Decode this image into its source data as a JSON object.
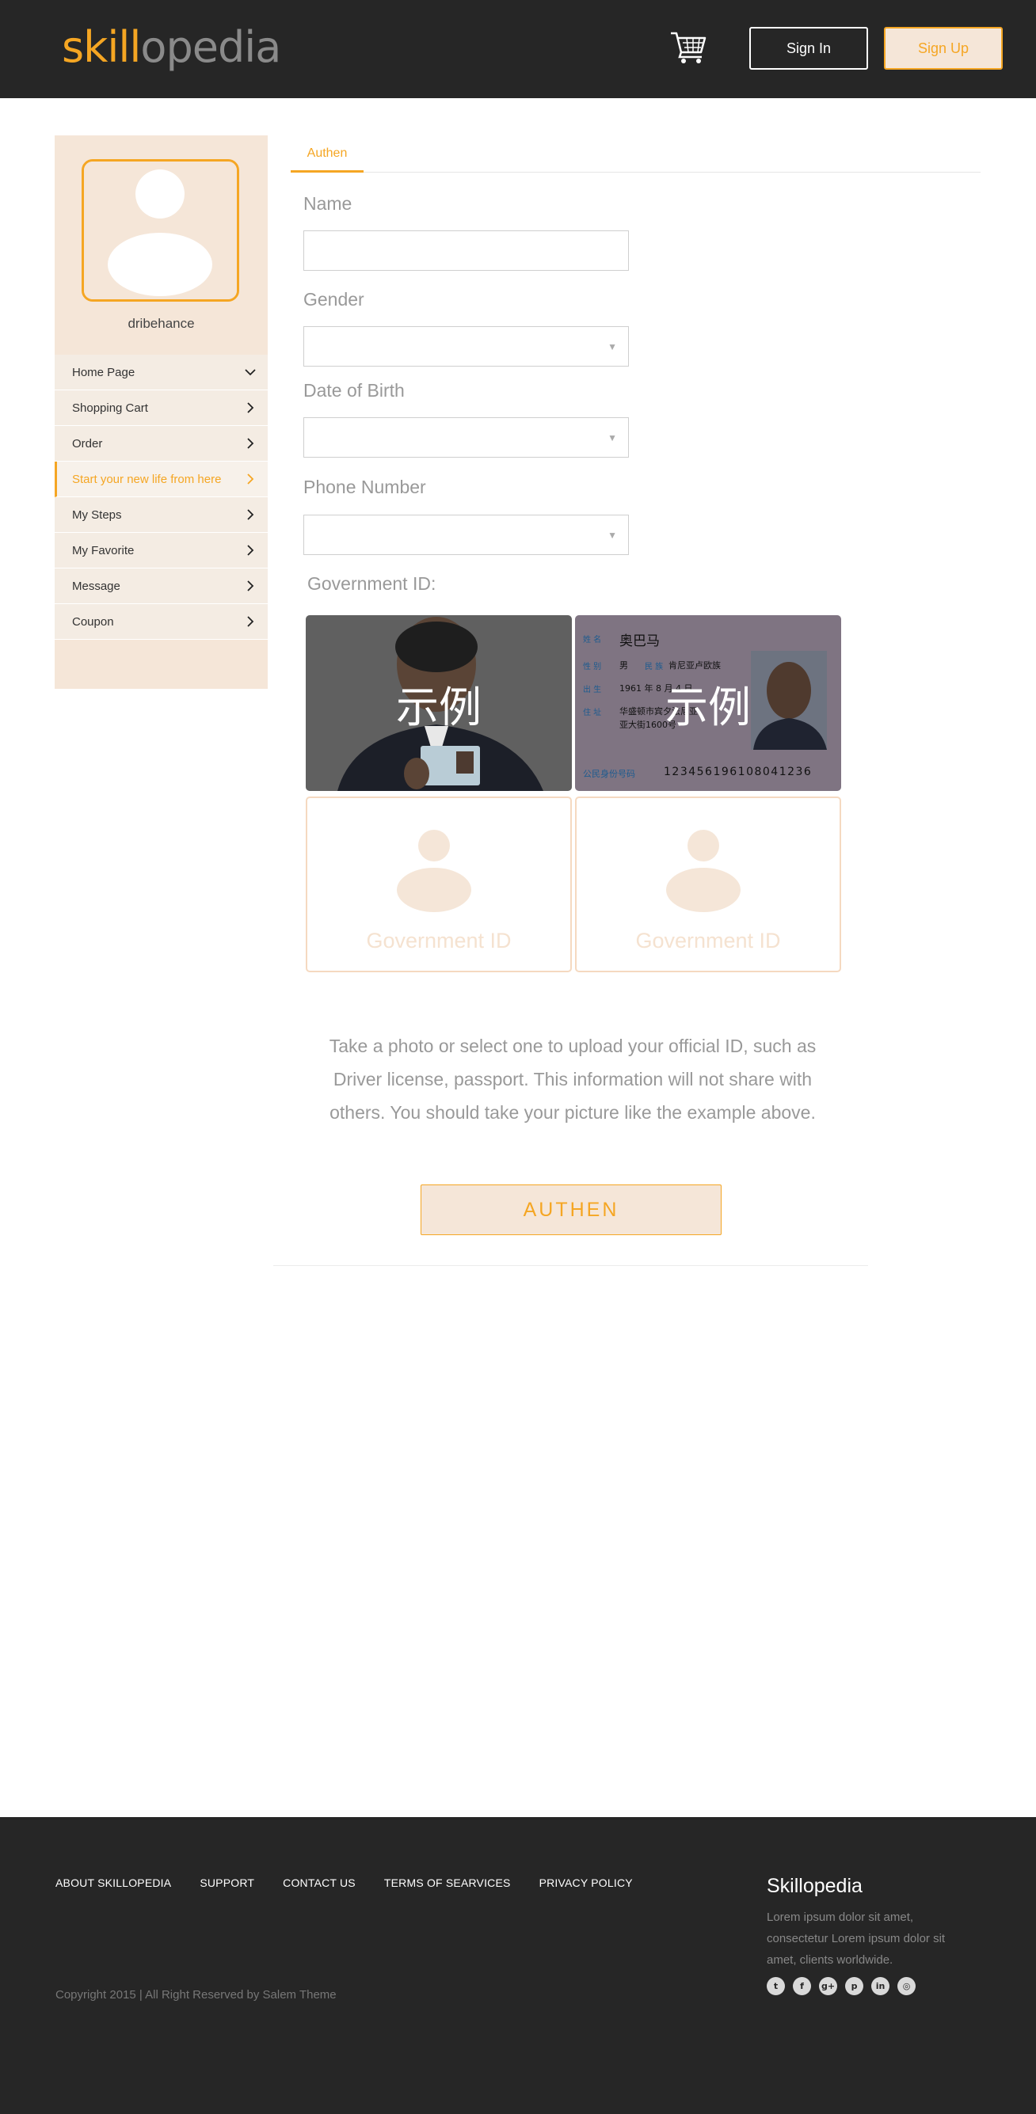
{
  "header": {
    "logo_part1": "skill",
    "logo_part2": "opedia",
    "signin_label": "Sign In",
    "signup_label": "Sign Up",
    "cart_icon": "shopping-cart-icon"
  },
  "sidebar": {
    "username": "dribehance",
    "items": [
      {
        "label": "Home Page",
        "icon": "chevron-down-icon"
      },
      {
        "label": "Shopping Cart",
        "icon": "chevron-right-icon"
      },
      {
        "label": "Order",
        "icon": "chevron-right-icon"
      },
      {
        "label": "Start your new life from here",
        "icon": "chevron-right-icon",
        "active": true
      },
      {
        "label": "My Steps",
        "icon": "chevron-right-icon"
      },
      {
        "label": "My Favorite",
        "icon": "chevron-right-icon"
      },
      {
        "label": "Message",
        "icon": "chevron-right-icon"
      },
      {
        "label": "Coupon",
        "icon": "chevron-right-icon"
      }
    ]
  },
  "main": {
    "tab_label": "Authen",
    "form": {
      "name_label": "Name",
      "name_value": "",
      "gender_label": "Gender",
      "gender_value": "",
      "dob_label": "Date of Birth",
      "dob_value": "",
      "phone_label": "Phone Number",
      "phone_value": ""
    },
    "gov_id_label": "Government ID:",
    "examples": [
      {
        "overlay": "示例"
      },
      {
        "overlay": "示例",
        "card_name_label": "姓 名",
        "card_name": "奥巴马",
        "card_sex_label": "性 别",
        "card_sex": "男",
        "card_nation_label": "民 族",
        "card_nation": "肯尼亚卢欧族",
        "card_birth_label": "出 生",
        "card_birth": "1961 年 8 月 4 日",
        "card_addr_label": "住 址",
        "card_addr1": "华盛顿市宾夕法尼亚",
        "card_addr2": "亚大街1600号",
        "card_id_label": "公民身份号码",
        "card_id": "123456196108041236"
      }
    ],
    "upload_slots": [
      {
        "label": "Government ID"
      },
      {
        "label": "Government ID"
      }
    ],
    "hint_text": "Take a photo or select one to upload your official ID, such as Driver license, passport. This information will not share with others. You should take your picture like the example above.",
    "submit_label": "AUTHEN"
  },
  "footer": {
    "links": [
      "ABOUT SKILLOPEDIA",
      "SUPPORT",
      "CONTACT US",
      "TERMS OF SEARVICES",
      "PRIVACY POLICY"
    ],
    "copyright": "Copyright 2015 | All Right Reserved by Salem Theme",
    "brand": "Skillopedia",
    "brand_desc": "Lorem ipsum dolor sit amet, consectetur Lorem ipsum dolor sit amet,  clients worldwide.",
    "socials": [
      "twitter-icon",
      "facebook-icon",
      "google-plus-icon",
      "pinterest-icon",
      "linkedin-icon",
      "dribbble-icon"
    ]
  },
  "colors": {
    "accent": "#f5a623",
    "header_bg": "#262626",
    "sidebar_bg": "#f5e6d8"
  }
}
